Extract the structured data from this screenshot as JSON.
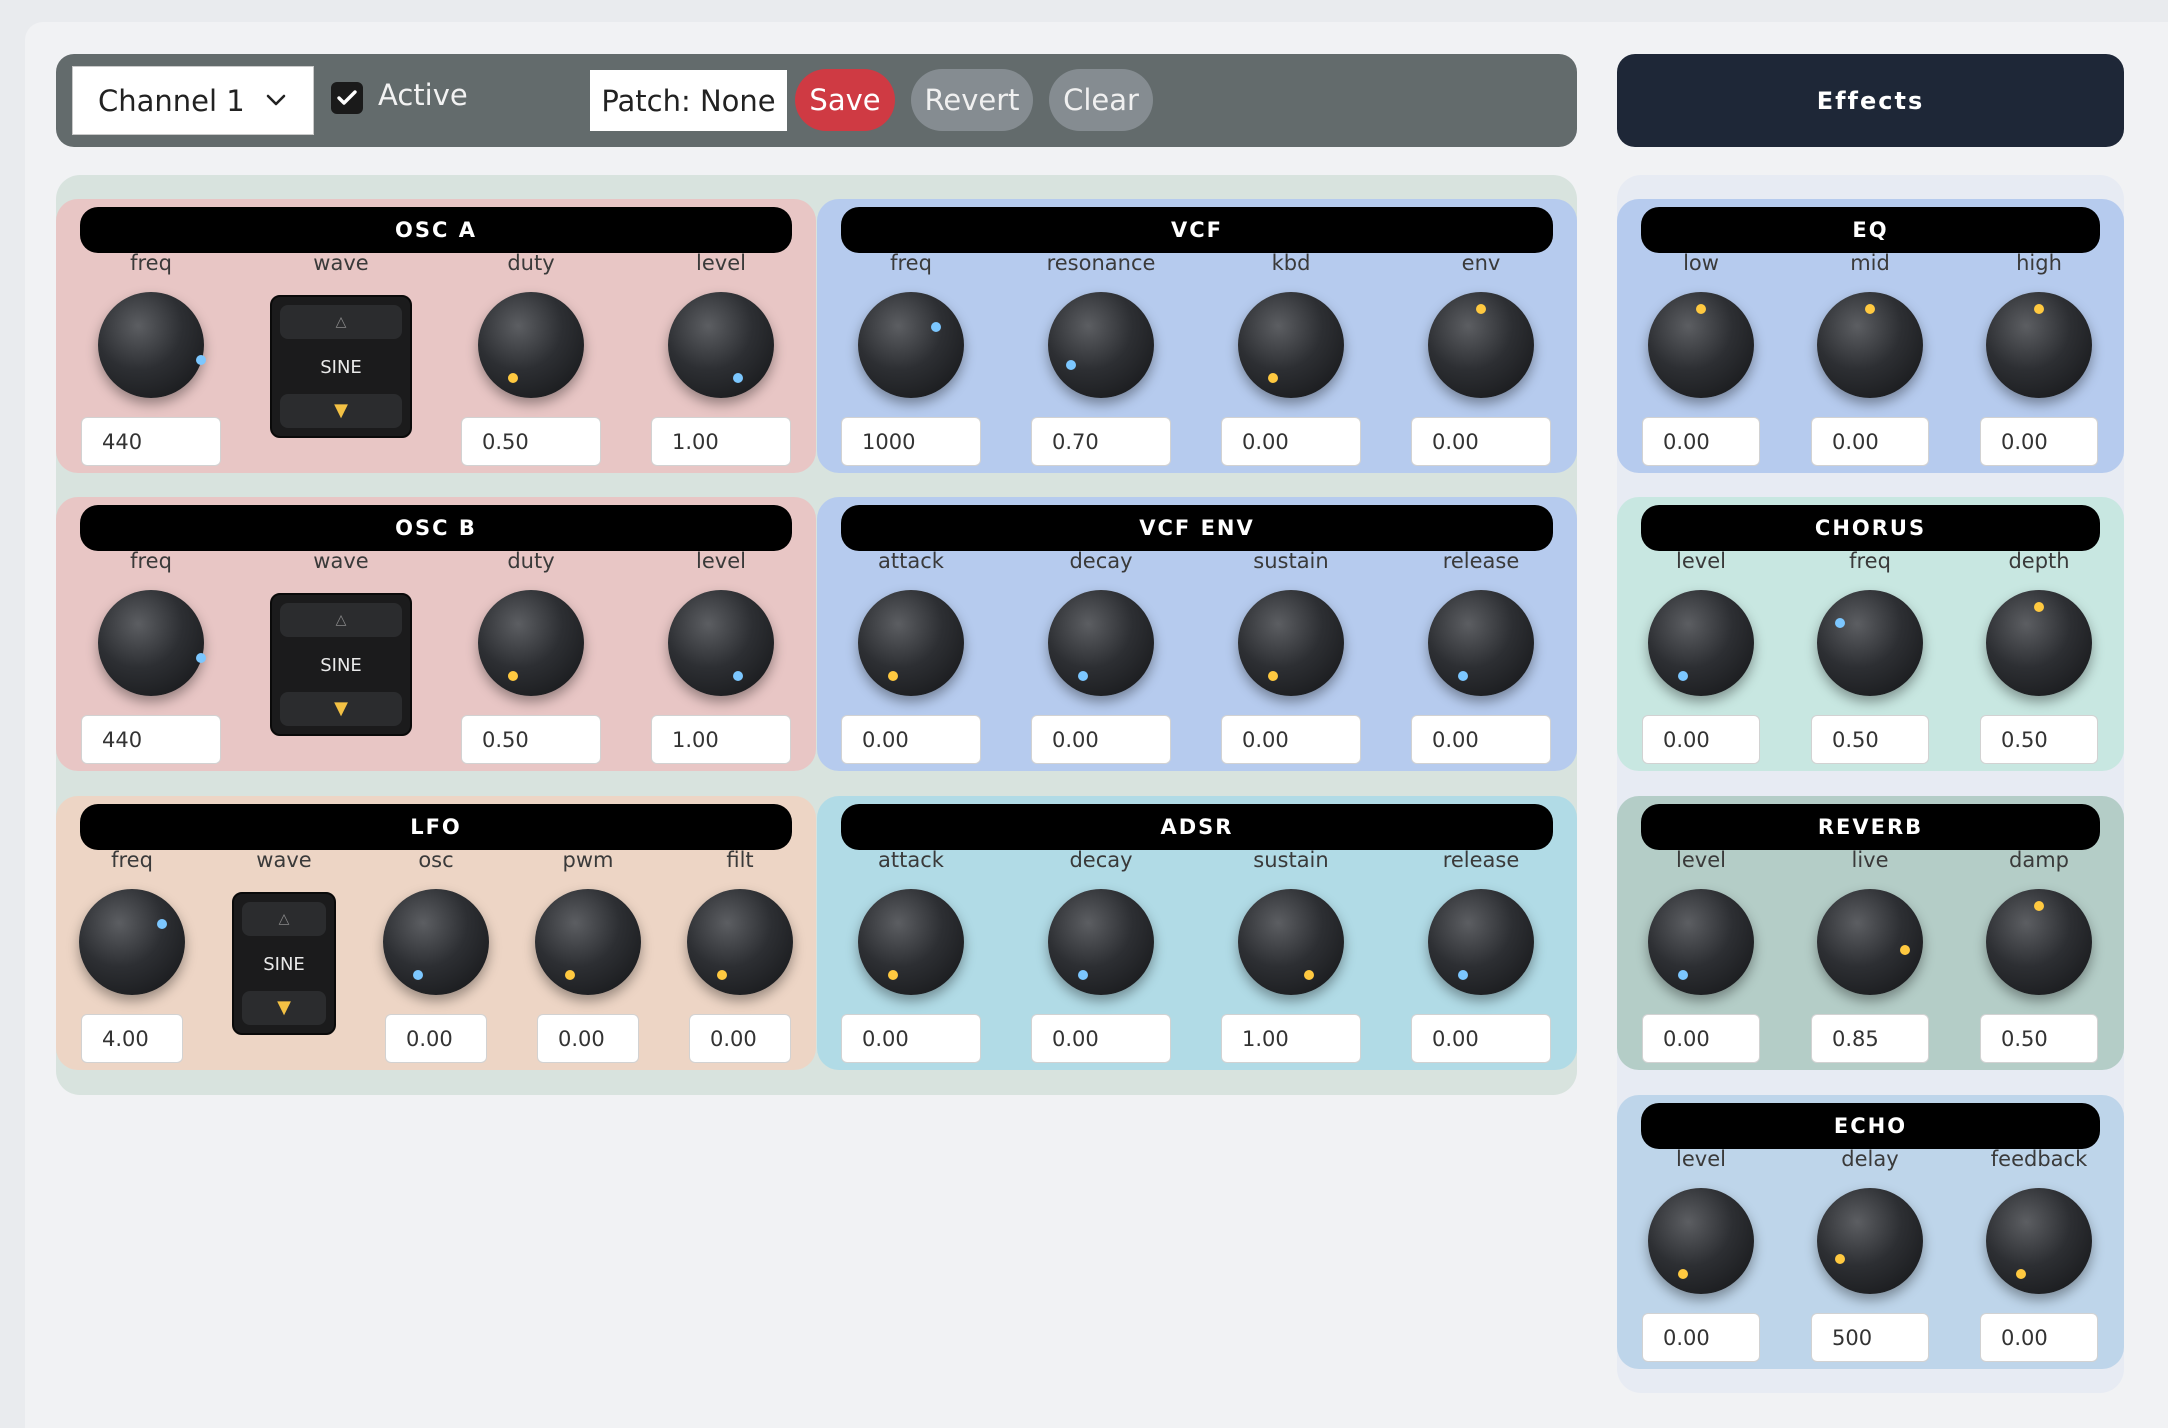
{
  "toolbar": {
    "channel": "Channel 1",
    "active_label": "Active",
    "active_checked": true,
    "patch": "Patch: None",
    "save": "Save",
    "revert": "Revert",
    "clear": "Clear"
  },
  "effects_button": "Effects",
  "panels": {
    "osc_a": {
      "title": "OSC A",
      "freq": {
        "label": "freq",
        "value": "440"
      },
      "wave": {
        "label": "wave",
        "value": "SINE"
      },
      "duty": {
        "label": "duty",
        "value": "0.50"
      },
      "level": {
        "label": "level",
        "value": "1.00"
      }
    },
    "osc_b": {
      "title": "OSC B",
      "freq": {
        "label": "freq",
        "value": "440"
      },
      "wave": {
        "label": "wave",
        "value": "SINE"
      },
      "duty": {
        "label": "duty",
        "value": "0.50"
      },
      "level": {
        "label": "level",
        "value": "1.00"
      }
    },
    "lfo": {
      "title": "LFO",
      "freq": {
        "label": "freq",
        "value": "4.00"
      },
      "wave": {
        "label": "wave",
        "value": "SINE"
      },
      "osc": {
        "label": "osc",
        "value": "0.00"
      },
      "pwm": {
        "label": "pwm",
        "value": "0.00"
      },
      "filt": {
        "label": "filt",
        "value": "0.00"
      }
    },
    "vcf": {
      "title": "VCF",
      "freq": {
        "label": "freq",
        "value": "1000"
      },
      "resonance": {
        "label": "resonance",
        "value": "0.70"
      },
      "kbd": {
        "label": "kbd",
        "value": "0.00"
      },
      "env": {
        "label": "env",
        "value": "0.00"
      }
    },
    "vcf_env": {
      "title": "VCF ENV",
      "attack": {
        "label": "attack",
        "value": "0.00"
      },
      "decay": {
        "label": "decay",
        "value": "0.00"
      },
      "sustain": {
        "label": "sustain",
        "value": "0.00"
      },
      "release": {
        "label": "release",
        "value": "0.00"
      }
    },
    "adsr": {
      "title": "ADSR",
      "attack": {
        "label": "attack",
        "value": "0.00"
      },
      "decay": {
        "label": "decay",
        "value": "0.00"
      },
      "sustain": {
        "label": "sustain",
        "value": "1.00"
      },
      "release": {
        "label": "release",
        "value": "0.00"
      }
    },
    "eq": {
      "title": "EQ",
      "low": {
        "label": "low",
        "value": "0.00"
      },
      "mid": {
        "label": "mid",
        "value": "0.00"
      },
      "high": {
        "label": "high",
        "value": "0.00"
      }
    },
    "chorus": {
      "title": "CHORUS",
      "level": {
        "label": "level",
        "value": "0.00"
      },
      "freq": {
        "label": "freq",
        "value": "0.50"
      },
      "depth": {
        "label": "depth",
        "value": "0.50"
      }
    },
    "reverb": {
      "title": "REVERB",
      "level": {
        "label": "level",
        "value": "0.00"
      },
      "live": {
        "label": "live",
        "value": "0.85"
      },
      "damp": {
        "label": "damp",
        "value": "0.50"
      }
    },
    "echo": {
      "title": "ECHO",
      "level": {
        "label": "level",
        "value": "0.00"
      },
      "delay": {
        "label": "delay",
        "value": "500"
      },
      "feedback": {
        "label": "feedback",
        "value": "0.00"
      }
    }
  },
  "colors": {
    "osc": "#e8c6c5",
    "lfo": "#edd5c5",
    "vcf": "#b6cbee",
    "adsr": "#b1dbe6",
    "eq": "#b6cbee",
    "chorus": "#c8e7e1",
    "reverb": "#b4cdc7",
    "echo": "#bed5ea",
    "knob_dot_blue": "#7cc7ff",
    "knob_dot_yellow": "#ffc940",
    "save": "#cf3a43"
  }
}
